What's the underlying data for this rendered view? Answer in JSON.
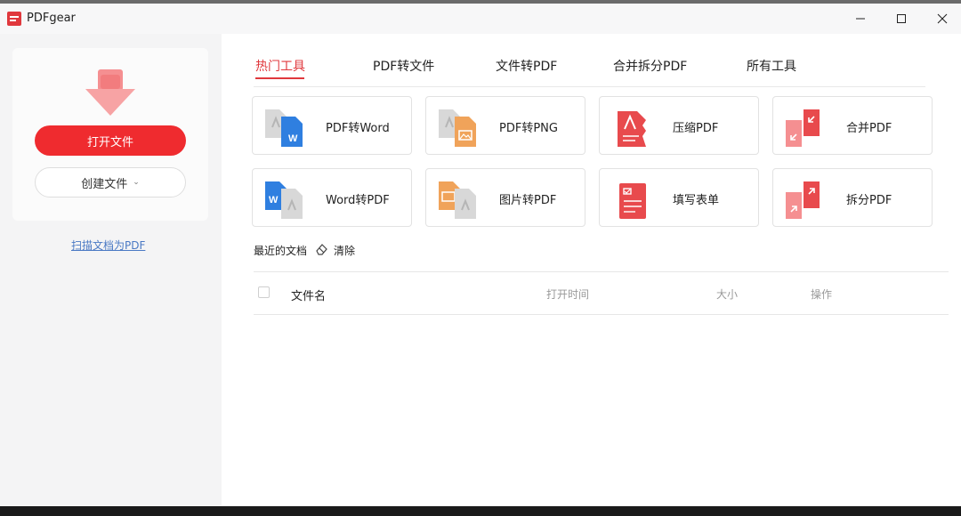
{
  "window": {
    "title": "PDFgear",
    "controls": [
      "minimize-icon",
      "maximize-icon",
      "close-icon"
    ]
  },
  "sidebar": {
    "open_label": "打开文件",
    "create_label": "创建文件",
    "create_chevron": "⌄",
    "scan_link": "扫描文档为PDF"
  },
  "tabs": [
    {
      "label": "热门工具",
      "active": true
    },
    {
      "label": "PDF转文件",
      "active": false
    },
    {
      "label": "文件转PDF",
      "active": false
    },
    {
      "label": "合并拆分PDF",
      "active": false
    },
    {
      "label": "所有工具",
      "active": false
    }
  ],
  "tools": [
    {
      "label": "PDF转Word",
      "icon": "pdf-to-word-icon"
    },
    {
      "label": "PDF转PNG",
      "icon": "pdf-to-png-icon"
    },
    {
      "label": "压缩PDF",
      "icon": "compress-pdf-icon"
    },
    {
      "label": "合并PDF",
      "icon": "merge-pdf-icon"
    },
    {
      "label": "Word转PDF",
      "icon": "word-to-pdf-icon"
    },
    {
      "label": "图片转PDF",
      "icon": "image-to-pdf-icon"
    },
    {
      "label": "填写表单",
      "icon": "fill-form-icon"
    },
    {
      "label": "拆分PDF",
      "icon": "split-pdf-icon"
    }
  ],
  "recent": {
    "title": "最近的文档",
    "clear_label": "清除",
    "columns": {
      "name": "文件名",
      "opened": "打开时间",
      "size": "大小",
      "actions": "操作"
    },
    "rows": []
  },
  "colors": {
    "accent": "#ef2b2f",
    "word_blue": "#2f7fe0",
    "image_orange": "#f0a35a"
  }
}
